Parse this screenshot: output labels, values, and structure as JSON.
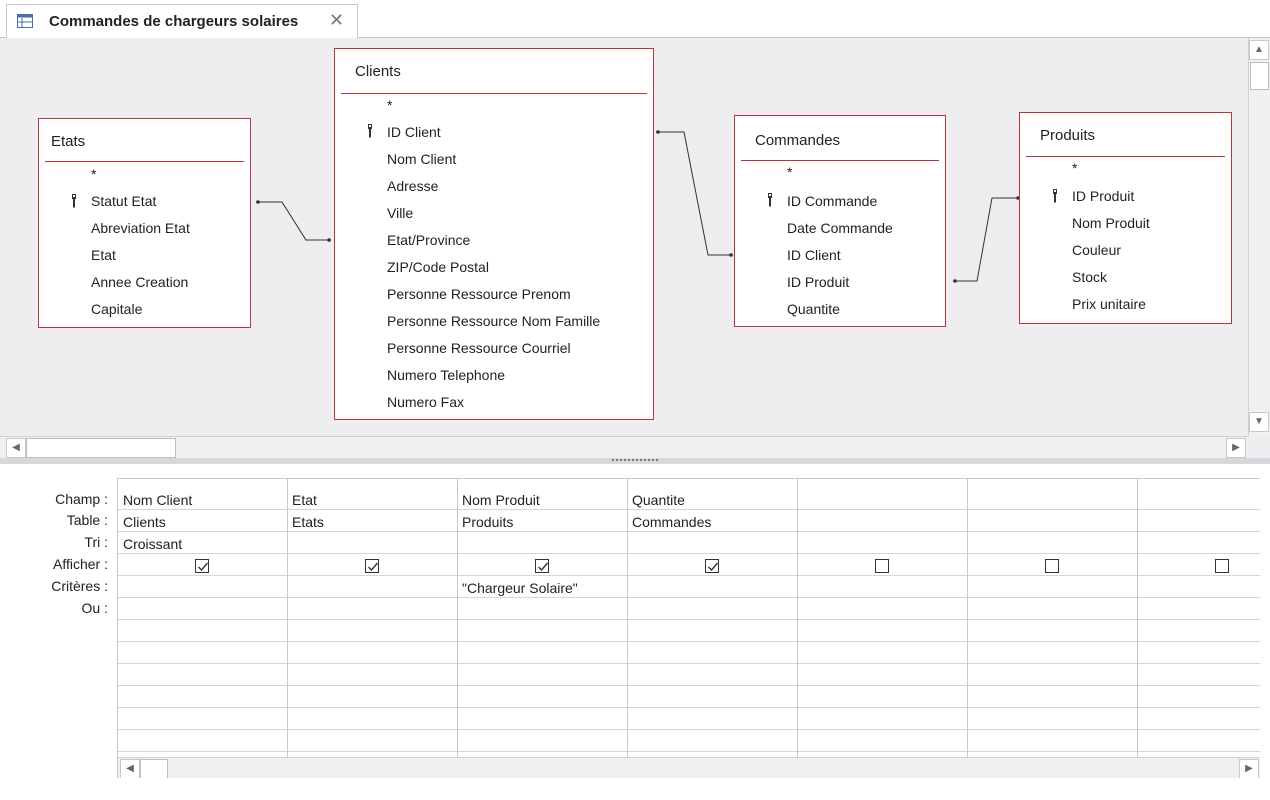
{
  "tab": {
    "title": "Commandes de chargeurs solaires",
    "close": "✕"
  },
  "tables": {
    "etats": {
      "title": "Etats",
      "fields": [
        "*",
        "Statut Etat",
        "Abreviation Etat",
        "Etat",
        "Annee Creation",
        "Capitale"
      ],
      "key_index": 1
    },
    "clients": {
      "title": "Clients",
      "fields": [
        "*",
        "ID Client",
        "Nom Client",
        "Adresse",
        "Ville",
        "Etat/Province",
        "ZIP/Code Postal",
        "Personne Ressource Prenom",
        "Personne Ressource Nom Famille",
        "Personne Ressource Courriel",
        "Numero Telephone",
        "Numero Fax"
      ],
      "key_index": 1
    },
    "commandes": {
      "title": "Commandes",
      "fields": [
        "*",
        "ID Commande",
        "Date Commande",
        "ID Client",
        "ID Produit",
        "Quantite"
      ],
      "key_index": 1
    },
    "produits": {
      "title": "Produits",
      "fields": [
        "*",
        "ID Produit",
        "Nom Produit",
        "Couleur",
        "Stock",
        "Prix unitaire"
      ],
      "key_index": 1
    }
  },
  "grid": {
    "row_labels": [
      "Champ :",
      "Table :",
      "Tri :",
      "Afficher :",
      "Critères :",
      "Ou :"
    ],
    "columns": [
      {
        "champ": "Nom Client",
        "table": "Clients",
        "tri": "Croissant",
        "afficher": true,
        "criteres": "",
        "ou": ""
      },
      {
        "champ": "Etat",
        "table": "Etats",
        "tri": "",
        "afficher": true,
        "criteres": "",
        "ou": ""
      },
      {
        "champ": "Nom Produit",
        "table": "Produits",
        "tri": "",
        "afficher": true,
        "criteres": "\"Chargeur Solaire\"",
        "ou": ""
      },
      {
        "champ": "Quantite",
        "table": "Commandes",
        "tri": "",
        "afficher": true,
        "criteres": "",
        "ou": ""
      },
      {
        "champ": "",
        "table": "",
        "tri": "",
        "afficher": false,
        "criteres": "",
        "ou": ""
      },
      {
        "champ": "",
        "table": "",
        "tri": "",
        "afficher": false,
        "criteres": "",
        "ou": ""
      },
      {
        "champ": "",
        "table": "",
        "tri": "",
        "afficher": false,
        "criteres": "",
        "ou": ""
      }
    ]
  },
  "icons": {
    "tab": "query-design-icon",
    "key": "primary-key-icon",
    "scroll_up": "scroll-up-arrow-icon",
    "scroll_down": "scroll-down-arrow-icon",
    "scroll_left": "scroll-left-arrow-icon",
    "scroll_right": "scroll-right-arrow-icon"
  },
  "colors": {
    "table_border": "#b23a3a",
    "pane_bg": "#eeeef0"
  }
}
